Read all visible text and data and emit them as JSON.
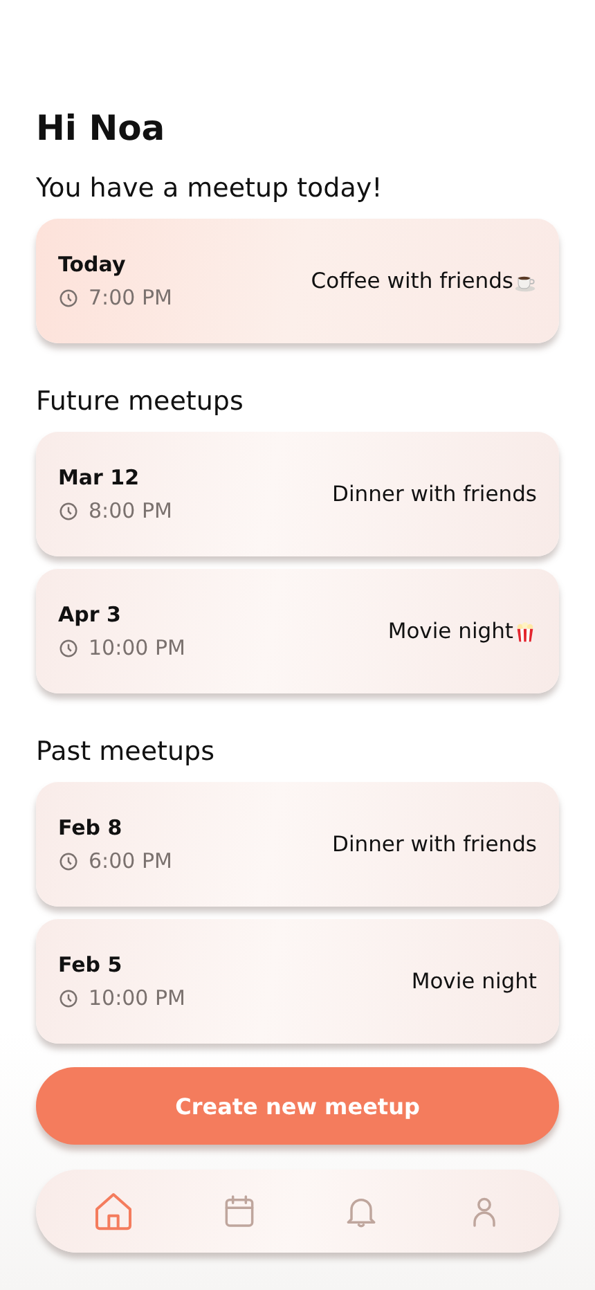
{
  "greeting": "Hi Noa",
  "today": {
    "heading": "You have a meetup today!",
    "meetups": [
      {
        "date": "Today",
        "time": "7:00 PM",
        "title": "Coffee with friends",
        "kind": "coffee",
        "highlight": true
      }
    ]
  },
  "future": {
    "heading": "Future meetups",
    "meetups": [
      {
        "date": "Mar 12",
        "time": "8:00 PM",
        "title": "Dinner with friends",
        "highlight": false
      },
      {
        "date": "Apr 3",
        "time": "10:00 PM",
        "title": "Movie night",
        "kind": "popcorn",
        "highlight": false
      }
    ]
  },
  "past": {
    "heading": "Past meetups",
    "meetups": [
      {
        "date": "Feb 8",
        "time": "6:00 PM",
        "title": "Dinner with friends",
        "highlight": false
      },
      {
        "date": "Feb 5",
        "time": "10:00 PM",
        "title": "Movie night",
        "highlight": false
      }
    ]
  },
  "create_button": "Create new meetup",
  "nav": [
    {
      "kind": "home",
      "selected": true
    },
    {
      "kind": "calendar",
      "selected": false
    },
    {
      "kind": "bell",
      "selected": false
    },
    {
      "kind": "profile",
      "selected": false
    }
  ]
}
